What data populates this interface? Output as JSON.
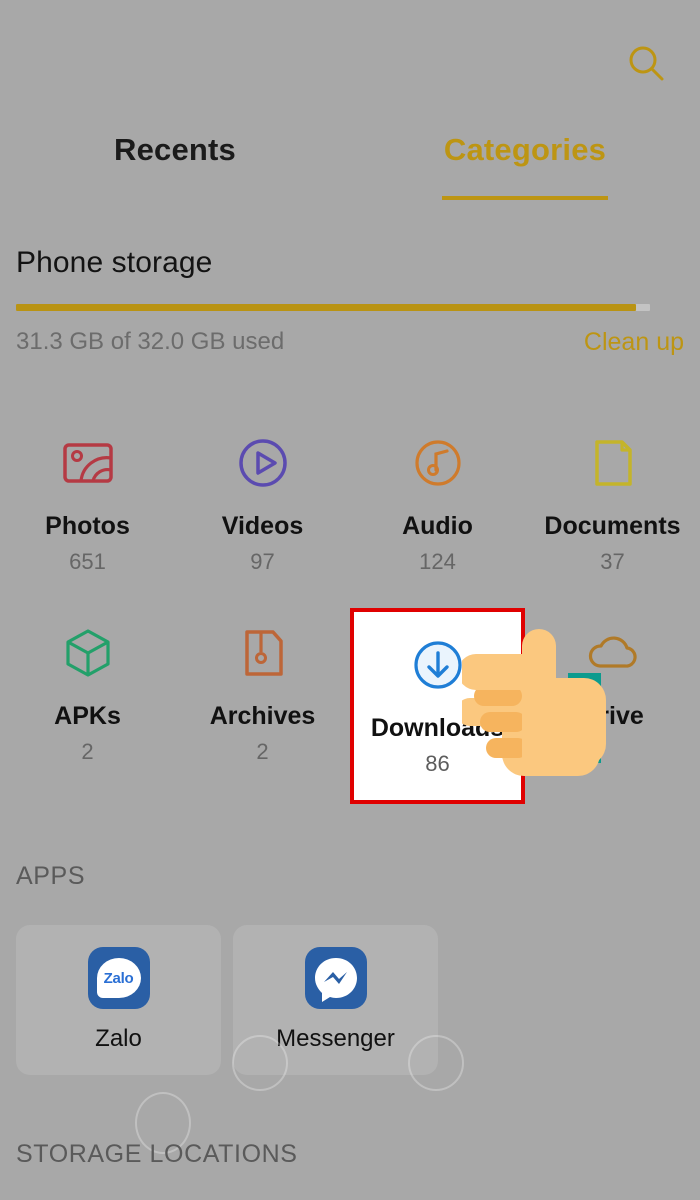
{
  "app": {
    "background_color": "#a8a8a8",
    "accent_color": "#bd9513",
    "highlight_color": "#e00000"
  },
  "topbar": {
    "search_icon": "search-icon"
  },
  "tabs": [
    {
      "label": "Recents",
      "active": false
    },
    {
      "label": "Categories",
      "active": true
    }
  ],
  "storage": {
    "title": "Phone storage",
    "used_text": "31.3 GB of 32.0 GB used",
    "clean_up_label": "Clean up",
    "used_gb": 31.3,
    "total_gb": 32.0,
    "percent_used": 97.8,
    "bar_color": "#b99313"
  },
  "categories": [
    {
      "label": "Photos",
      "count": "651",
      "icon": "photos-icon",
      "color": "#b53a44"
    },
    {
      "label": "Videos",
      "count": "97",
      "icon": "videos-icon",
      "color": "#5b4bb0"
    },
    {
      "label": "Audio",
      "count": "124",
      "icon": "audio-icon",
      "color": "#cf7b2c"
    },
    {
      "label": "Documents",
      "count": "37",
      "icon": "documents-icon",
      "color": "#c4b42a"
    },
    {
      "label": "APKs",
      "count": "2",
      "icon": "apks-icon",
      "color": "#23a06a"
    },
    {
      "label": "Archives",
      "count": "2",
      "icon": "archives-icon",
      "color": "#bd6638"
    },
    {
      "label": "Downloads",
      "count": "86",
      "icon": "downloads-icon",
      "color": "#1f7ed6",
      "highlighted": true
    },
    {
      "label": "Drive",
      "count": "",
      "icon": "drive-cloud-icon",
      "color": "#b07a28"
    }
  ],
  "apps": {
    "header": "APPS",
    "items": [
      {
        "label": "Zalo",
        "icon": "zalo-icon",
        "icon_text": "Zalo"
      },
      {
        "label": "Messenger",
        "icon": "messenger-icon"
      }
    ]
  },
  "storage_locations": {
    "header": "STORAGE LOCATIONS"
  },
  "cursor": {
    "type": "pointing-hand-cursor",
    "skin_color": "#fbc87f",
    "target": "Downloads"
  }
}
